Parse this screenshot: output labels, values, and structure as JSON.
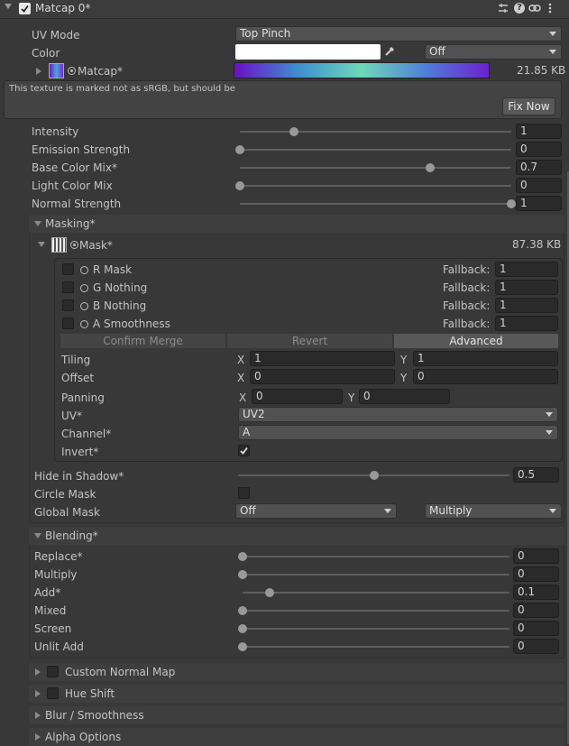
{
  "header": {
    "title": "Matcap 0*",
    "enabled": true,
    "icons": [
      "presets-icon",
      "help-icon",
      "link-icon",
      "menu-kebab-icon"
    ]
  },
  "uv_mode": {
    "label": "UV Mode",
    "value": "Top Pinch"
  },
  "color": {
    "label": "Color",
    "swatch": "#ffffff",
    "mode": "Off"
  },
  "matcap": {
    "label": "Matcap*",
    "size": "21.85 KB",
    "gradient": [
      "#6a0fc7",
      "#3e8fd0",
      "#6ed8b8",
      "#4f80d8",
      "#6c20d0"
    ]
  },
  "warning": {
    "text": "This texture is marked not as sRGB, but should be",
    "button": "Fix Now"
  },
  "sliders": [
    {
      "label": "Intensity",
      "value": "1",
      "fraction": 0.2
    },
    {
      "label": "Emission Strength",
      "value": "0",
      "fraction": 0.0
    },
    {
      "label": "Base Color Mix*",
      "value": "0.7",
      "fraction": 0.7
    },
    {
      "label": "Light Color Mix",
      "value": "0",
      "fraction": 0.0
    },
    {
      "label": "Normal Strength",
      "value": "1",
      "fraction": 1.0
    }
  ],
  "masking": {
    "title": "Masking*",
    "mask": {
      "label": "Mask*",
      "size": "87.38 KB"
    },
    "channels": [
      {
        "label": "R Mask",
        "fallback_label": "Fallback:",
        "fallback": "1"
      },
      {
        "label": "G Nothing",
        "fallback_label": "Fallback:",
        "fallback": "1"
      },
      {
        "label": "B Nothing",
        "fallback_label": "Fallback:",
        "fallback": "1"
      },
      {
        "label": "A Smoothness",
        "fallback_label": "Fallback:",
        "fallback": "1"
      }
    ],
    "buttons": {
      "confirm": "Confirm Merge",
      "revert": "Revert",
      "advanced": "Advanced"
    },
    "tiling": {
      "label": "Tiling",
      "x_label": "X",
      "x": "1",
      "y_label": "Y",
      "y": "1"
    },
    "offset": {
      "label": "Offset",
      "x_label": "X",
      "x": "0",
      "y_label": "Y",
      "y": "0"
    },
    "panning": {
      "label": "Panning",
      "x_label": "X",
      "x": "0",
      "y_label": "Y",
      "y": "0"
    },
    "uv": {
      "label": "UV*",
      "value": "UV2"
    },
    "channel": {
      "label": "Channel*",
      "value": "A"
    },
    "invert": {
      "label": "Invert*",
      "checked": true
    },
    "hide_in_shadow": {
      "label": "Hide in Shadow*",
      "value": "0.5",
      "fraction": 0.5
    },
    "circle_mask": {
      "label": "Circle Mask",
      "checked": false
    },
    "global_mask": {
      "label": "Global Mask",
      "value": "Off",
      "mode": "Multiply"
    }
  },
  "blending": {
    "title": "Blending*",
    "sliders": [
      {
        "label": "Replace*",
        "value": "0",
        "fraction": 0.0
      },
      {
        "label": "Multiply",
        "value": "0",
        "fraction": 0.0
      },
      {
        "label": "Add*",
        "value": "0.1",
        "fraction": 0.1
      },
      {
        "label": "Mixed",
        "value": "0",
        "fraction": 0.0
      },
      {
        "label": "Screen",
        "value": "0",
        "fraction": 0.0
      },
      {
        "label": "Unlit Add",
        "value": "0",
        "fraction": 0.0
      }
    ]
  },
  "collapsed_sections": [
    {
      "label": "Custom Normal Map",
      "has_toggle": true
    },
    {
      "label": "Hue Shift",
      "has_toggle": true
    },
    {
      "label": "Blur / Smoothness",
      "has_toggle": false
    },
    {
      "label": "Alpha Options",
      "has_toggle": false
    }
  ]
}
